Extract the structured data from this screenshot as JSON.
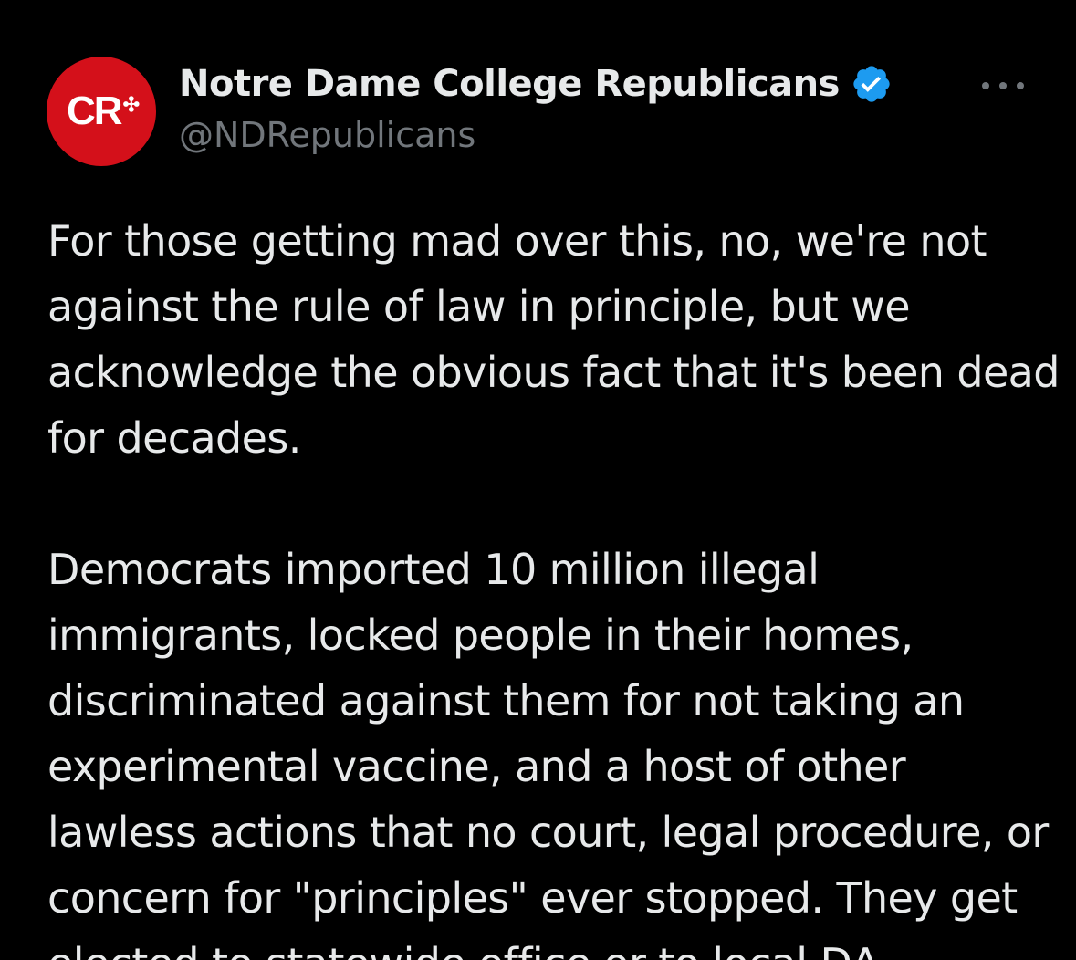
{
  "author": {
    "display_name": "Notre Dame College Republicans",
    "handle": "@NDRepublicans",
    "avatar_text": "CR",
    "avatar_mark": "✣",
    "avatar_color": "#d4101a",
    "verified_icon": "verified-badge-icon",
    "verified_color": "#1d9bf0"
  },
  "menu": {
    "icon": "more-options-icon"
  },
  "tweet": {
    "text": "For those getting mad over this, no, we're not against the rule of law in principle, but we acknowledge the obvious fact that it's been dead for decades.\n\nDemocrats imported 10 million illegal immigrants, locked people in their homes, discriminated against them for not taking an experimental vaccine, and a host of other lawless actions that no court, legal procedure, or concern for \"principles\" ever stopped. They get elected to statewide office or to local DA"
  }
}
